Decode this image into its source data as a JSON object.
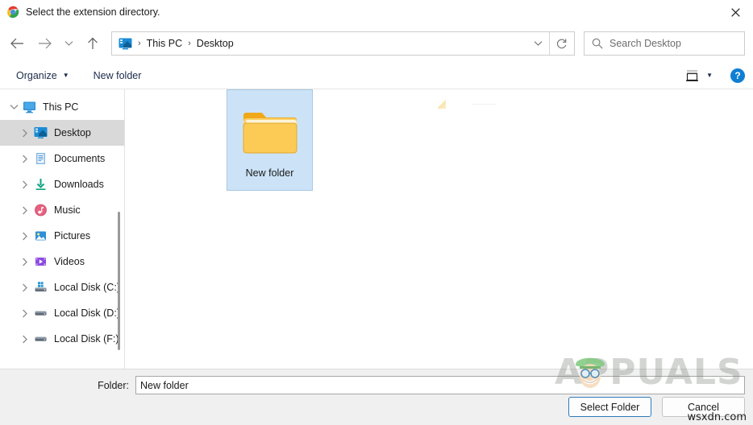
{
  "window": {
    "title": "Select the extension directory.",
    "app_icon": "chrome-icon",
    "close_label": "✕"
  },
  "nav": {
    "back_label": "←",
    "forward_label": "→",
    "recent_label": "⌄",
    "up_label": "↑",
    "refresh_label": "⟳",
    "dropdown_label": "⌄"
  },
  "breadcrumb": {
    "icon": "desktop-icon",
    "separator": "›",
    "items": [
      "This PC",
      "Desktop"
    ]
  },
  "search": {
    "icon": "search-icon",
    "placeholder": "Search Desktop",
    "value": ""
  },
  "commandbar": {
    "organize_label": "Organize",
    "organize_caret": "▼",
    "new_folder_label": "New folder",
    "view_caret": "▼",
    "view_icon": "layout-view-icon",
    "help_label": "?"
  },
  "sidebar": {
    "items": [
      {
        "label": "This PC",
        "icon": "this-pc-icon",
        "expander": "chevron-down",
        "depth": 0,
        "selected": false
      },
      {
        "label": "Desktop",
        "icon": "desktop-icon",
        "expander": "chevron-right",
        "depth": 1,
        "selected": true
      },
      {
        "label": "Documents",
        "icon": "documents-icon",
        "expander": "chevron-right",
        "depth": 1,
        "selected": false
      },
      {
        "label": "Downloads",
        "icon": "downloads-icon",
        "expander": "chevron-right",
        "depth": 1,
        "selected": false
      },
      {
        "label": "Music",
        "icon": "music-icon",
        "expander": "chevron-right",
        "depth": 1,
        "selected": false
      },
      {
        "label": "Pictures",
        "icon": "pictures-icon",
        "expander": "chevron-right",
        "depth": 1,
        "selected": false
      },
      {
        "label": "Videos",
        "icon": "videos-icon",
        "expander": "chevron-right",
        "depth": 1,
        "selected": false
      },
      {
        "label": "Local Disk (C:)",
        "icon": "system-disk-icon",
        "expander": "chevron-right",
        "depth": 1,
        "selected": false
      },
      {
        "label": "Local Disk (D:)",
        "icon": "disk-icon",
        "expander": "chevron-right",
        "depth": 1,
        "selected": false
      },
      {
        "label": "Local Disk (F:)",
        "icon": "disk-icon",
        "expander": "chevron-right",
        "depth": 1,
        "selected": false
      }
    ]
  },
  "content": {
    "files": [
      {
        "name": "New folder",
        "icon": "folder-icon",
        "selected": true
      }
    ]
  },
  "footer": {
    "folder_label": "Folder:",
    "folder_value": "New folder",
    "select_button": "Select Folder",
    "cancel_button": "Cancel"
  },
  "watermarks": {
    "brand": "APPUALS",
    "site": "wsxdn.com"
  },
  "colors": {
    "accent": "#0f7fd4",
    "selection_file": "#cce3f7",
    "selection_tree": "#d9d9d9",
    "footer_bg": "#f0f0f0",
    "default_button_border": "#2e7ab8",
    "folder_yellow": "#f7c948"
  }
}
